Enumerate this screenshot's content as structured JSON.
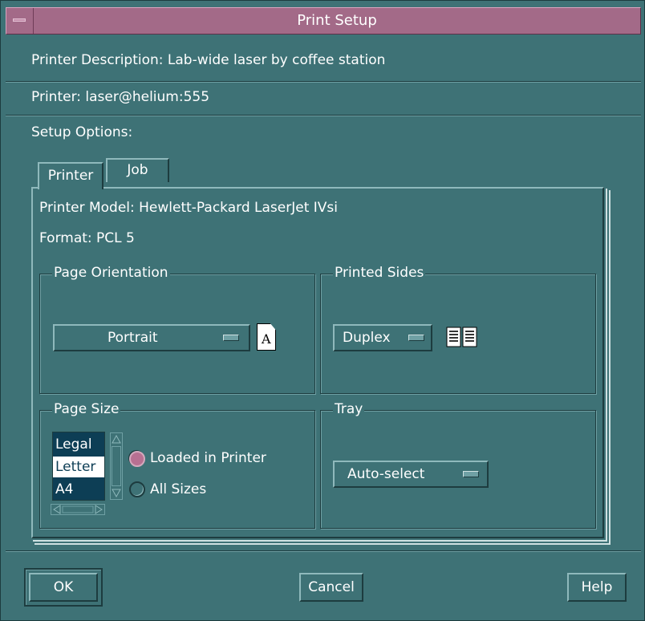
{
  "window": {
    "title": "Print Setup"
  },
  "printer_description": {
    "label": "Printer Description:",
    "value": "Lab-wide laser by coffee station"
  },
  "printer": {
    "label": "Printer:",
    "value": "laser@helium:555"
  },
  "setup_options": {
    "label": "Setup Options:"
  },
  "tabs": [
    {
      "label": "Printer",
      "active": true
    },
    {
      "label": "Job",
      "active": false
    }
  ],
  "printer_tab": {
    "model": {
      "label": "Printer Model:",
      "value": "Hewlett-Packard LaserJet IVsi"
    },
    "format": {
      "label": "Format:",
      "value": "PCL 5"
    },
    "page_orientation": {
      "title": "Page Orientation",
      "selected": "Portrait",
      "icon_letter": "A"
    },
    "printed_sides": {
      "title": "Printed Sides",
      "selected": "Duplex"
    },
    "page_size": {
      "title": "Page Size",
      "sizes": [
        "Legal",
        "Letter",
        "A4"
      ],
      "selected_size": "Letter",
      "radio_options": [
        {
          "label": "Loaded in Printer",
          "selected": true
        },
        {
          "label": "All Sizes",
          "selected": false
        }
      ]
    },
    "tray": {
      "title": "Tray",
      "selected": "Auto-select"
    }
  },
  "buttons": {
    "ok": "OK",
    "cancel": "Cancel",
    "help": "Help"
  },
  "colors": {
    "background": "#3e7276",
    "titlebar": "#a36a88",
    "radio_selected": "#b87092",
    "list_background": "#0d3e55"
  }
}
